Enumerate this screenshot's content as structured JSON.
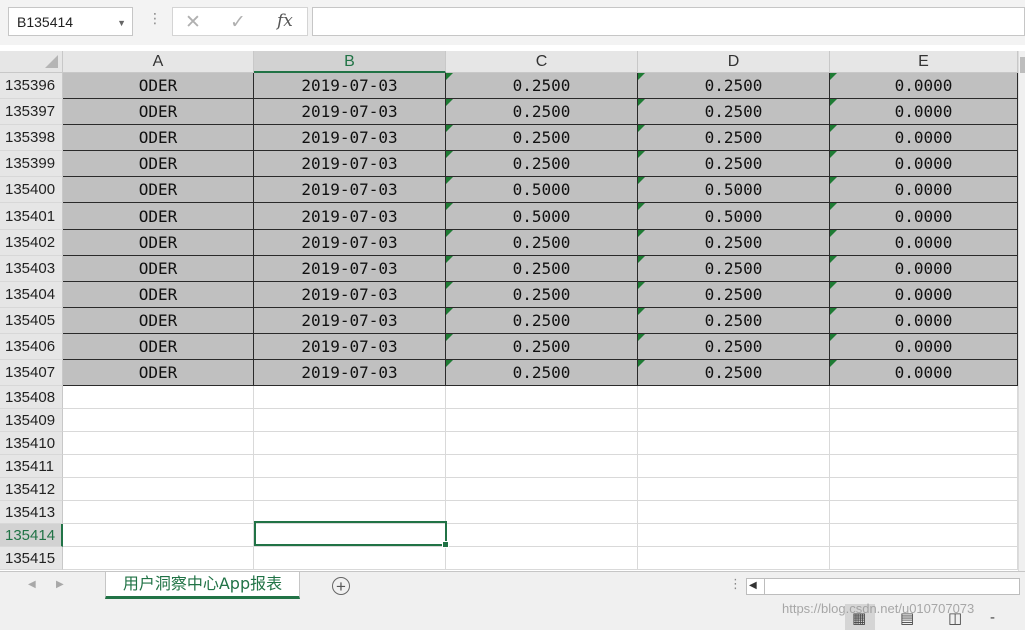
{
  "name_box": {
    "value": "B135414"
  },
  "formula_bar": {
    "cancel_glyph": "✕",
    "enter_glyph": "✓",
    "fx_label": "fx",
    "content": ""
  },
  "columns": [
    "A",
    "B",
    "C",
    "D",
    "E"
  ],
  "active_column": "B",
  "rows": [
    {
      "num": "135396",
      "cells": [
        "ODER",
        "2019-07-03",
        "0.2500",
        "0.2500",
        "0.0000"
      ]
    },
    {
      "num": "135397",
      "cells": [
        "ODER",
        "2019-07-03",
        "0.2500",
        "0.2500",
        "0.0000"
      ]
    },
    {
      "num": "135398",
      "cells": [
        "ODER",
        "2019-07-03",
        "0.2500",
        "0.2500",
        "0.0000"
      ]
    },
    {
      "num": "135399",
      "cells": [
        "ODER",
        "2019-07-03",
        "0.2500",
        "0.2500",
        "0.0000"
      ]
    },
    {
      "num": "135400",
      "cells": [
        "ODER",
        "2019-07-03",
        "0.5000",
        "0.5000",
        "0.0000"
      ]
    },
    {
      "num": "135401",
      "cells": [
        "ODER",
        "2019-07-03",
        "0.5000",
        "0.5000",
        "0.0000"
      ]
    },
    {
      "num": "135402",
      "cells": [
        "ODER",
        "2019-07-03",
        "0.2500",
        "0.2500",
        "0.0000"
      ]
    },
    {
      "num": "135403",
      "cells": [
        "ODER",
        "2019-07-03",
        "0.2500",
        "0.2500",
        "0.0000"
      ]
    },
    {
      "num": "135404",
      "cells": [
        "ODER",
        "2019-07-03",
        "0.2500",
        "0.2500",
        "0.0000"
      ]
    },
    {
      "num": "135405",
      "cells": [
        "ODER",
        "2019-07-03",
        "0.2500",
        "0.2500",
        "0.0000"
      ]
    },
    {
      "num": "135406",
      "cells": [
        "ODER",
        "2019-07-03",
        "0.2500",
        "0.2500",
        "0.0000"
      ]
    },
    {
      "num": "135407",
      "cells": [
        "ODER",
        "2019-07-03",
        "0.2500",
        "0.2500",
        "0.0000"
      ]
    },
    {
      "num": "135408",
      "cells": [
        "",
        "",
        "",
        "",
        ""
      ]
    },
    {
      "num": "135409",
      "cells": [
        "",
        "",
        "",
        "",
        ""
      ]
    },
    {
      "num": "135410",
      "cells": [
        "",
        "",
        "",
        "",
        ""
      ]
    },
    {
      "num": "135411",
      "cells": [
        "",
        "",
        "",
        "",
        ""
      ]
    },
    {
      "num": "135412",
      "cells": [
        "",
        "",
        "",
        "",
        ""
      ]
    },
    {
      "num": "135413",
      "cells": [
        "",
        "",
        "",
        "",
        ""
      ]
    },
    {
      "num": "135414",
      "cells": [
        "",
        "",
        "",
        "",
        ""
      ]
    },
    {
      "num": "135415",
      "cells": [
        "",
        "",
        "",
        "",
        ""
      ]
    }
  ],
  "active_row": "135414",
  "sheet_tabs": [
    {
      "label": "用户洞察中心App报表",
      "active": true
    }
  ],
  "tab_nav": {
    "prev": "◀",
    "next": "▶",
    "add": "+"
  },
  "status_bar": {
    "views": [
      "normal-view",
      "page-layout-view",
      "page-break-view"
    ],
    "zoom_glyph": "-"
  },
  "watermark": "https://blog.csdn.net/u010707073",
  "colors": {
    "accent": "#217346",
    "filled_cell": "#c0c0c0",
    "error_triangle": "#1e7b34"
  }
}
